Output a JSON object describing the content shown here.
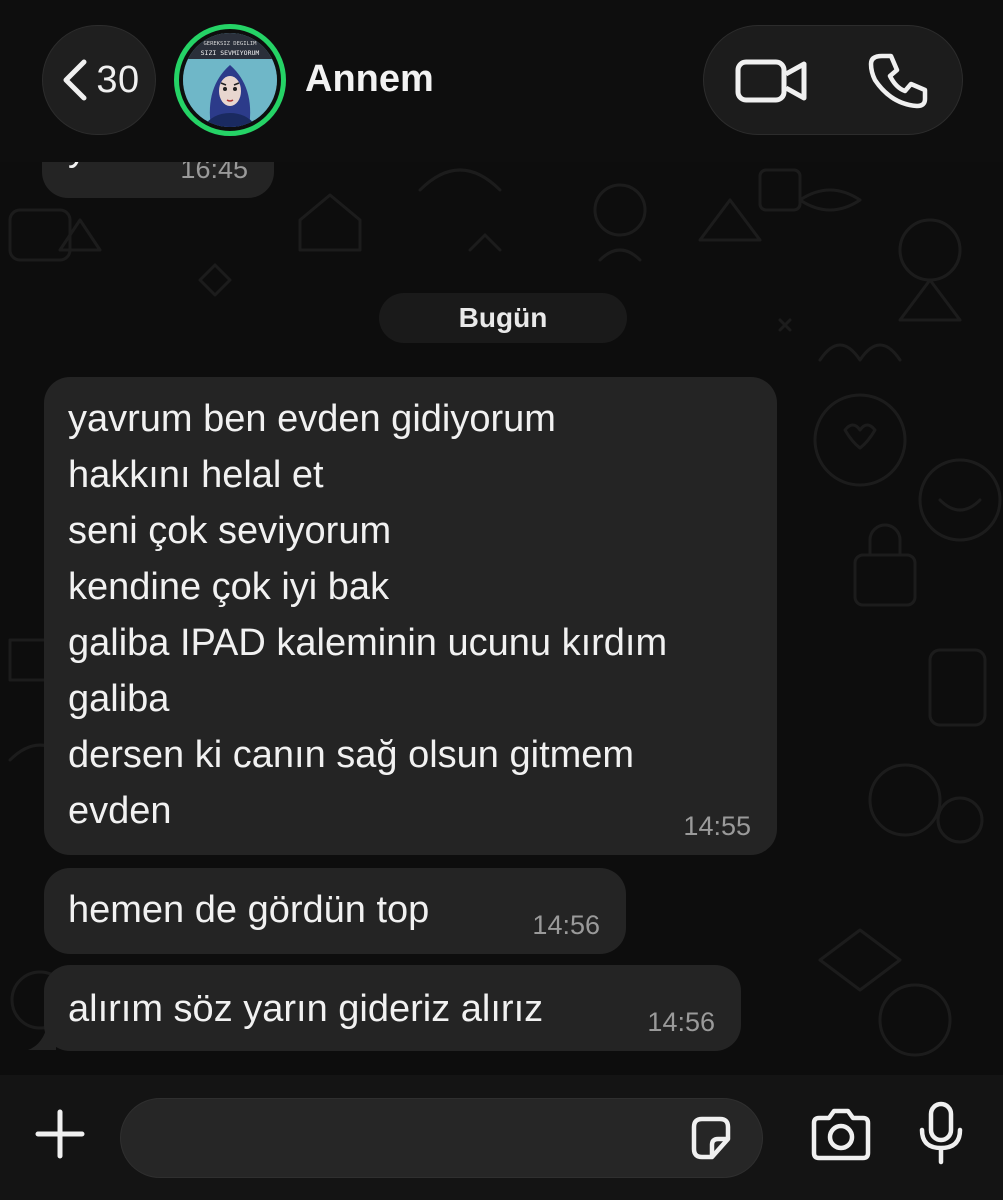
{
  "header": {
    "back_count": "30",
    "contact_name": "Annem",
    "avatar_caption_top": "GEREKSIZ DEGILIM",
    "avatar_caption_bottom": "SIZI SEVMIYORUM"
  },
  "messages": {
    "previous": {
      "text": "yok",
      "time": "16:45"
    },
    "date_separator": "Bugün",
    "items": [
      {
        "text": "yavrum ben evden gidiyorum\nhakkını helal et\nseni çok seviyorum\nkendine çok iyi bak\ngaliba IPAD kaleminin ucunu kırdım\ngaliba\ndersen ki canın sağ olsun gitmem\nevden",
        "time": "14:55"
      },
      {
        "text": "hemen de gördün top",
        "time": "14:56"
      },
      {
        "text": "alırım söz yarın gideriz alırız",
        "time": "14:56"
      }
    ]
  },
  "composer": {
    "placeholder": ""
  },
  "colors": {
    "accent_ring": "#25d366",
    "bubble": "#242424",
    "background": "#0d0d0d"
  },
  "icons": {
    "back": "chevron-left-icon",
    "video": "video-camera-icon",
    "phone": "phone-icon",
    "plus": "plus-icon",
    "sticker": "sticker-icon",
    "camera": "camera-icon",
    "mic": "microphone-icon"
  }
}
